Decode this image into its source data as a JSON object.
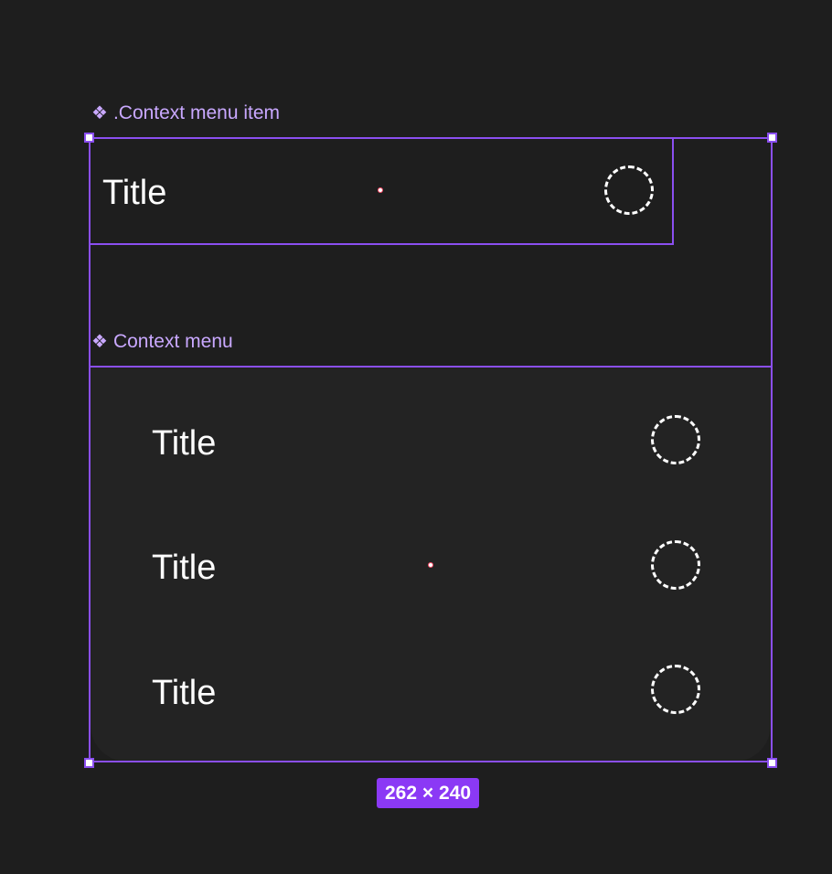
{
  "component_item": {
    "label": ".Context menu item",
    "title": "Title",
    "icon_name": "placeholder-dashed-circle-icon"
  },
  "context_menu": {
    "label": "Context menu",
    "items": [
      {
        "title": "Title",
        "icon_name": "placeholder-dashed-circle-icon"
      },
      {
        "title": "Title",
        "icon_name": "placeholder-dashed-circle-icon"
      },
      {
        "title": "Title",
        "icon_name": "placeholder-dashed-circle-icon"
      }
    ]
  },
  "selection": {
    "size_label": "262 × 240"
  },
  "colors": {
    "background": "#1e1e1e",
    "selection": "#8b4ff0",
    "label": "#c9a8ff",
    "badge": "#8b39f5",
    "menu_panel": "#232323"
  },
  "icons": {
    "component": "component-diamond-icon"
  }
}
